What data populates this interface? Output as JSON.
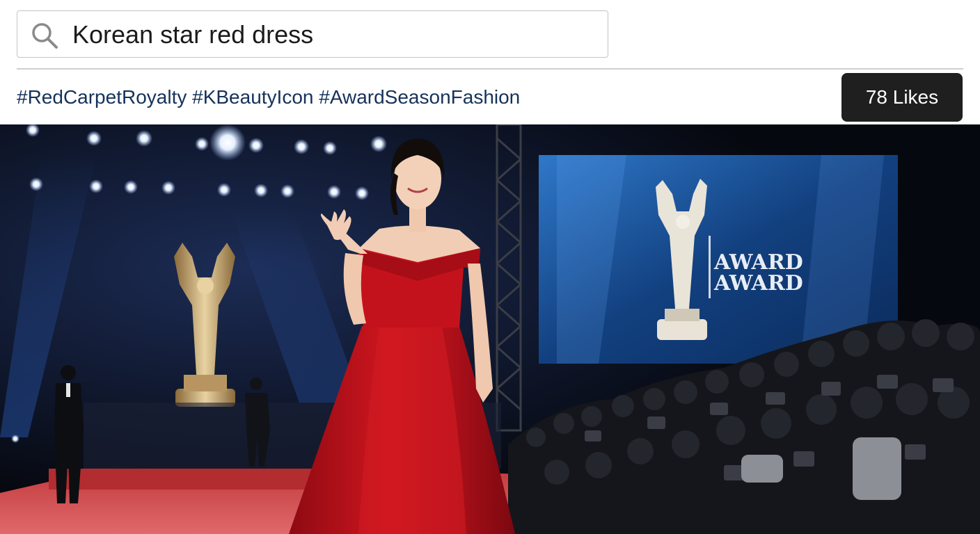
{
  "search": {
    "query": "Korean star red dress"
  },
  "post": {
    "hashtags": "#RedCarpetRoyalty #KBeautyIcon #AwardSeasonFashion",
    "likes_label": "78 Likes",
    "screen_text_line1": "AWARD",
    "screen_text_line2": "AWARD"
  },
  "icons": {
    "search": "search-icon"
  },
  "colors": {
    "hashtag": "#16325a",
    "likes_bg": "#1f1f1f",
    "dress_red": "#c4121c",
    "carpet": "#d44a4c",
    "screen_blue": "#1a4f95"
  }
}
